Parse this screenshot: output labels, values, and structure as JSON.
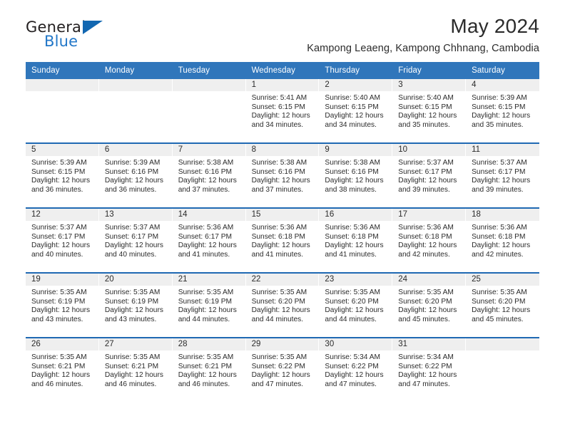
{
  "brand": {
    "name_top": "General",
    "name_bottom": "Blue",
    "accent_color": "#2277c8",
    "flag_color": "#1267b1"
  },
  "header": {
    "title": "May 2024",
    "subtitle": "Kampong Leaeng, Kampong Chhnang, Cambodia"
  },
  "calendar": {
    "header_color": "#3076bb",
    "row_rule_color": "#1f69b3",
    "daynum_band_color": "#efefef",
    "weekdays": [
      "Sunday",
      "Monday",
      "Tuesday",
      "Wednesday",
      "Thursday",
      "Friday",
      "Saturday"
    ],
    "weeks": [
      [
        {
          "day": "",
          "sunrise": "",
          "sunset": "",
          "daylight_line1": "",
          "daylight_line2": "",
          "empty": true
        },
        {
          "day": "",
          "sunrise": "",
          "sunset": "",
          "daylight_line1": "",
          "daylight_line2": "",
          "empty": true
        },
        {
          "day": "",
          "sunrise": "",
          "sunset": "",
          "daylight_line1": "",
          "daylight_line2": "",
          "empty": true
        },
        {
          "day": "1",
          "sunrise": "Sunrise: 5:41 AM",
          "sunset": "Sunset: 6:15 PM",
          "daylight_line1": "Daylight: 12 hours",
          "daylight_line2": "and 34 minutes."
        },
        {
          "day": "2",
          "sunrise": "Sunrise: 5:40 AM",
          "sunset": "Sunset: 6:15 PM",
          "daylight_line1": "Daylight: 12 hours",
          "daylight_line2": "and 34 minutes."
        },
        {
          "day": "3",
          "sunrise": "Sunrise: 5:40 AM",
          "sunset": "Sunset: 6:15 PM",
          "daylight_line1": "Daylight: 12 hours",
          "daylight_line2": "and 35 minutes."
        },
        {
          "day": "4",
          "sunrise": "Sunrise: 5:39 AM",
          "sunset": "Sunset: 6:15 PM",
          "daylight_line1": "Daylight: 12 hours",
          "daylight_line2": "and 35 minutes."
        }
      ],
      [
        {
          "day": "5",
          "sunrise": "Sunrise: 5:39 AM",
          "sunset": "Sunset: 6:15 PM",
          "daylight_line1": "Daylight: 12 hours",
          "daylight_line2": "and 36 minutes."
        },
        {
          "day": "6",
          "sunrise": "Sunrise: 5:39 AM",
          "sunset": "Sunset: 6:16 PM",
          "daylight_line1": "Daylight: 12 hours",
          "daylight_line2": "and 36 minutes."
        },
        {
          "day": "7",
          "sunrise": "Sunrise: 5:38 AM",
          "sunset": "Sunset: 6:16 PM",
          "daylight_line1": "Daylight: 12 hours",
          "daylight_line2": "and 37 minutes."
        },
        {
          "day": "8",
          "sunrise": "Sunrise: 5:38 AM",
          "sunset": "Sunset: 6:16 PM",
          "daylight_line1": "Daylight: 12 hours",
          "daylight_line2": "and 37 minutes."
        },
        {
          "day": "9",
          "sunrise": "Sunrise: 5:38 AM",
          "sunset": "Sunset: 6:16 PM",
          "daylight_line1": "Daylight: 12 hours",
          "daylight_line2": "and 38 minutes."
        },
        {
          "day": "10",
          "sunrise": "Sunrise: 5:37 AM",
          "sunset": "Sunset: 6:17 PM",
          "daylight_line1": "Daylight: 12 hours",
          "daylight_line2": "and 39 minutes."
        },
        {
          "day": "11",
          "sunrise": "Sunrise: 5:37 AM",
          "sunset": "Sunset: 6:17 PM",
          "daylight_line1": "Daylight: 12 hours",
          "daylight_line2": "and 39 minutes."
        }
      ],
      [
        {
          "day": "12",
          "sunrise": "Sunrise: 5:37 AM",
          "sunset": "Sunset: 6:17 PM",
          "daylight_line1": "Daylight: 12 hours",
          "daylight_line2": "and 40 minutes."
        },
        {
          "day": "13",
          "sunrise": "Sunrise: 5:37 AM",
          "sunset": "Sunset: 6:17 PM",
          "daylight_line1": "Daylight: 12 hours",
          "daylight_line2": "and 40 minutes."
        },
        {
          "day": "14",
          "sunrise": "Sunrise: 5:36 AM",
          "sunset": "Sunset: 6:17 PM",
          "daylight_line1": "Daylight: 12 hours",
          "daylight_line2": "and 41 minutes."
        },
        {
          "day": "15",
          "sunrise": "Sunrise: 5:36 AM",
          "sunset": "Sunset: 6:18 PM",
          "daylight_line1": "Daylight: 12 hours",
          "daylight_line2": "and 41 minutes."
        },
        {
          "day": "16",
          "sunrise": "Sunrise: 5:36 AM",
          "sunset": "Sunset: 6:18 PM",
          "daylight_line1": "Daylight: 12 hours",
          "daylight_line2": "and 41 minutes."
        },
        {
          "day": "17",
          "sunrise": "Sunrise: 5:36 AM",
          "sunset": "Sunset: 6:18 PM",
          "daylight_line1": "Daylight: 12 hours",
          "daylight_line2": "and 42 minutes."
        },
        {
          "day": "18",
          "sunrise": "Sunrise: 5:36 AM",
          "sunset": "Sunset: 6:18 PM",
          "daylight_line1": "Daylight: 12 hours",
          "daylight_line2": "and 42 minutes."
        }
      ],
      [
        {
          "day": "19",
          "sunrise": "Sunrise: 5:35 AM",
          "sunset": "Sunset: 6:19 PM",
          "daylight_line1": "Daylight: 12 hours",
          "daylight_line2": "and 43 minutes."
        },
        {
          "day": "20",
          "sunrise": "Sunrise: 5:35 AM",
          "sunset": "Sunset: 6:19 PM",
          "daylight_line1": "Daylight: 12 hours",
          "daylight_line2": "and 43 minutes."
        },
        {
          "day": "21",
          "sunrise": "Sunrise: 5:35 AM",
          "sunset": "Sunset: 6:19 PM",
          "daylight_line1": "Daylight: 12 hours",
          "daylight_line2": "and 44 minutes."
        },
        {
          "day": "22",
          "sunrise": "Sunrise: 5:35 AM",
          "sunset": "Sunset: 6:20 PM",
          "daylight_line1": "Daylight: 12 hours",
          "daylight_line2": "and 44 minutes."
        },
        {
          "day": "23",
          "sunrise": "Sunrise: 5:35 AM",
          "sunset": "Sunset: 6:20 PM",
          "daylight_line1": "Daylight: 12 hours",
          "daylight_line2": "and 44 minutes."
        },
        {
          "day": "24",
          "sunrise": "Sunrise: 5:35 AM",
          "sunset": "Sunset: 6:20 PM",
          "daylight_line1": "Daylight: 12 hours",
          "daylight_line2": "and 45 minutes."
        },
        {
          "day": "25",
          "sunrise": "Sunrise: 5:35 AM",
          "sunset": "Sunset: 6:20 PM",
          "daylight_line1": "Daylight: 12 hours",
          "daylight_line2": "and 45 minutes."
        }
      ],
      [
        {
          "day": "26",
          "sunrise": "Sunrise: 5:35 AM",
          "sunset": "Sunset: 6:21 PM",
          "daylight_line1": "Daylight: 12 hours",
          "daylight_line2": "and 46 minutes."
        },
        {
          "day": "27",
          "sunrise": "Sunrise: 5:35 AM",
          "sunset": "Sunset: 6:21 PM",
          "daylight_line1": "Daylight: 12 hours",
          "daylight_line2": "and 46 minutes."
        },
        {
          "day": "28",
          "sunrise": "Sunrise: 5:35 AM",
          "sunset": "Sunset: 6:21 PM",
          "daylight_line1": "Daylight: 12 hours",
          "daylight_line2": "and 46 minutes."
        },
        {
          "day": "29",
          "sunrise": "Sunrise: 5:35 AM",
          "sunset": "Sunset: 6:22 PM",
          "daylight_line1": "Daylight: 12 hours",
          "daylight_line2": "and 47 minutes."
        },
        {
          "day": "30",
          "sunrise": "Sunrise: 5:34 AM",
          "sunset": "Sunset: 6:22 PM",
          "daylight_line1": "Daylight: 12 hours",
          "daylight_line2": "and 47 minutes."
        },
        {
          "day": "31",
          "sunrise": "Sunrise: 5:34 AM",
          "sunset": "Sunset: 6:22 PM",
          "daylight_line1": "Daylight: 12 hours",
          "daylight_line2": "and 47 minutes."
        },
        {
          "day": "",
          "sunrise": "",
          "sunset": "",
          "daylight_line1": "",
          "daylight_line2": "",
          "empty": true
        }
      ]
    ]
  }
}
